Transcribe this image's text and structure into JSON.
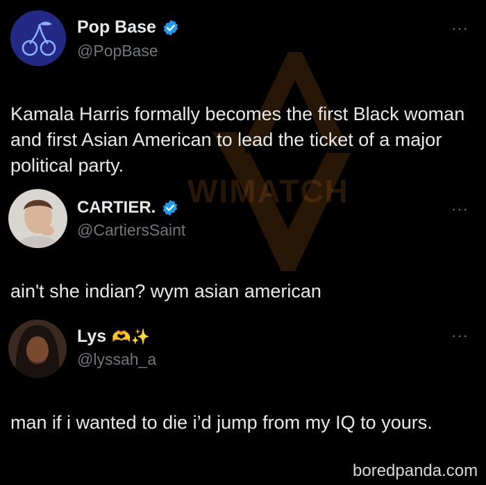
{
  "posts": [
    {
      "display_name": "Pop Base",
      "verified": true,
      "handle": "@PopBase",
      "text": "Kamala Harris formally becomes the first Black woman and first Asian American to lead the ticket of a major political party.",
      "more": "···"
    },
    {
      "display_name": "Cartier.",
      "verified": true,
      "handle": "@CartiersSaint",
      "text": "ain't she indian? wym asian american",
      "more": "···"
    },
    {
      "display_name": "Lys",
      "name_emoji": "🫶✨",
      "verified": false,
      "handle": "@lyssah_a",
      "text": "man if i wanted to die i’d jump from my IQ to yours.",
      "more": "···"
    }
  ],
  "watermark": {
    "text": "WIMATCH"
  },
  "footer": {
    "site": "boredpanda.com"
  },
  "colors": {
    "background": "#000000",
    "text": "#e7e9ea",
    "secondary": "#71767b",
    "verified": "#1d9bf0",
    "watermark": "#b5651d"
  }
}
